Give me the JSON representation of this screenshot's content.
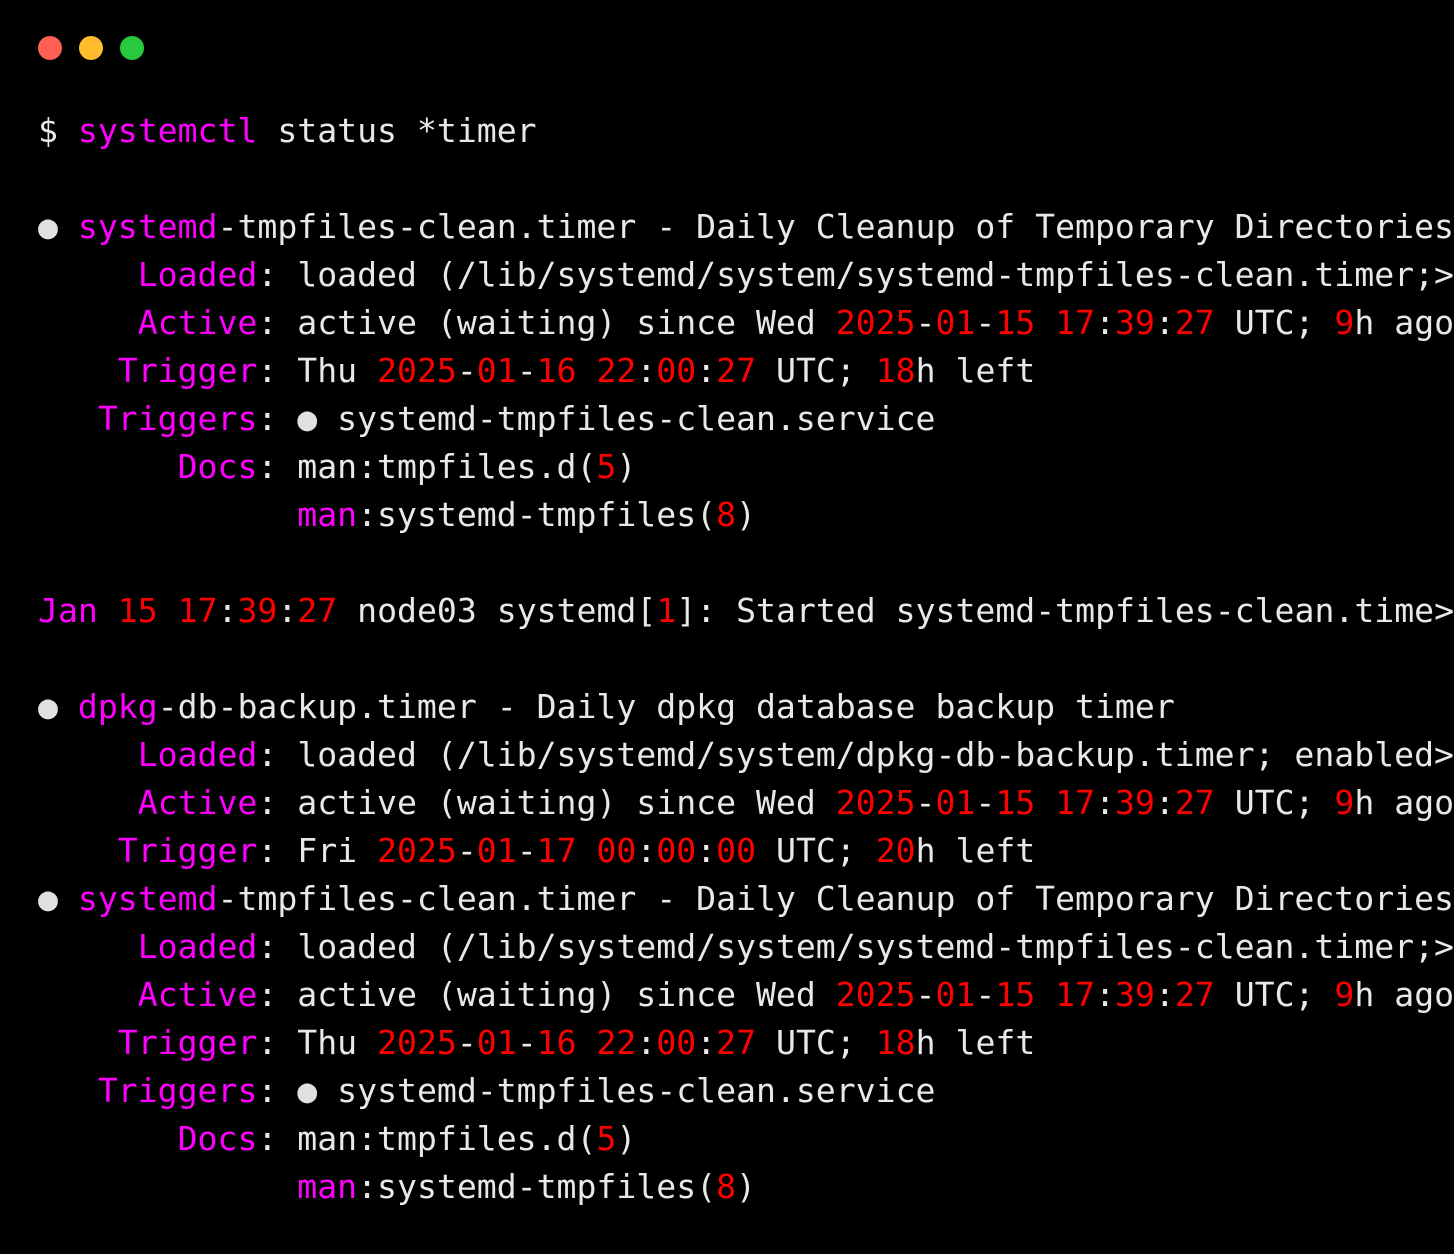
{
  "window": {
    "title": "Terminal",
    "controls": [
      {
        "name": "close",
        "color": "#ff5f56"
      },
      {
        "name": "minimize",
        "color": "#ffbd2e"
      },
      {
        "name": "maximize",
        "color": "#27c93f"
      }
    ]
  },
  "terminal": {
    "background": "#000000",
    "foreground": "#e8e8e8",
    "accent_magenta": "#ff00ff",
    "accent_red": "#ff0000",
    "prompt_symbol": "$",
    "command": "systemctl status *timer",
    "full_command_line": "$ systemctl status *timer"
  },
  "lines": [
    {
      "id": "prompt",
      "tokens": [
        {
          "t": "$ ",
          "c": "white"
        },
        {
          "t": "systemctl",
          "c": "magenta"
        },
        {
          "t": " status *timer",
          "c": "white"
        }
      ]
    },
    {
      "id": "blank-1",
      "tokens": [
        {
          "t": "",
          "c": "white"
        }
      ]
    },
    {
      "id": "unit1-header",
      "tokens": [
        {
          "t": "● ",
          "c": "bullet"
        },
        {
          "t": "systemd",
          "c": "magenta"
        },
        {
          "t": "-tmpfiles-clean.timer - Daily Cleanup of Temporary Directories",
          "c": "white"
        }
      ]
    },
    {
      "id": "unit1-loaded",
      "tokens": [
        {
          "t": "     ",
          "c": "white"
        },
        {
          "t": "Loaded",
          "c": "magenta"
        },
        {
          "t": ": loaded (/lib/systemd/system/systemd-tmpfiles-clean.timer;>",
          "c": "white"
        }
      ]
    },
    {
      "id": "unit1-active",
      "tokens": [
        {
          "t": "     ",
          "c": "white"
        },
        {
          "t": "Active",
          "c": "magenta"
        },
        {
          "t": ": active (waiting) since Wed ",
          "c": "white"
        },
        {
          "t": "2025",
          "c": "red"
        },
        {
          "t": "-",
          "c": "white"
        },
        {
          "t": "01",
          "c": "red"
        },
        {
          "t": "-",
          "c": "white"
        },
        {
          "t": "15",
          "c": "red"
        },
        {
          "t": " ",
          "c": "white"
        },
        {
          "t": "17",
          "c": "red"
        },
        {
          "t": ":",
          "c": "white"
        },
        {
          "t": "39",
          "c": "red"
        },
        {
          "t": ":",
          "c": "white"
        },
        {
          "t": "27",
          "c": "red"
        },
        {
          "t": " UTC; ",
          "c": "white"
        },
        {
          "t": "9",
          "c": "red"
        },
        {
          "t": "h ago",
          "c": "white"
        }
      ]
    },
    {
      "id": "unit1-trigger",
      "tokens": [
        {
          "t": "    ",
          "c": "white"
        },
        {
          "t": "Trigger",
          "c": "magenta"
        },
        {
          "t": ": Thu ",
          "c": "white"
        },
        {
          "t": "2025",
          "c": "red"
        },
        {
          "t": "-",
          "c": "white"
        },
        {
          "t": "01",
          "c": "red"
        },
        {
          "t": "-",
          "c": "white"
        },
        {
          "t": "16",
          "c": "red"
        },
        {
          "t": " ",
          "c": "white"
        },
        {
          "t": "22",
          "c": "red"
        },
        {
          "t": ":",
          "c": "white"
        },
        {
          "t": "00",
          "c": "red"
        },
        {
          "t": ":",
          "c": "white"
        },
        {
          "t": "27",
          "c": "red"
        },
        {
          "t": " UTC; ",
          "c": "white"
        },
        {
          "t": "18",
          "c": "red"
        },
        {
          "t": "h left",
          "c": "white"
        }
      ]
    },
    {
      "id": "unit1-triggers",
      "tokens": [
        {
          "t": "   ",
          "c": "white"
        },
        {
          "t": "Triggers",
          "c": "magenta"
        },
        {
          "t": ": ",
          "c": "white"
        },
        {
          "t": "●",
          "c": "bullet"
        },
        {
          "t": " systemd-tmpfiles-clean.service",
          "c": "white"
        }
      ]
    },
    {
      "id": "unit1-docs",
      "tokens": [
        {
          "t": "       ",
          "c": "white"
        },
        {
          "t": "Docs",
          "c": "magenta"
        },
        {
          "t": ": man:tmpfiles.d(",
          "c": "white"
        },
        {
          "t": "5",
          "c": "red"
        },
        {
          "t": ")",
          "c": "white"
        }
      ]
    },
    {
      "id": "unit1-docs-2",
      "tokens": [
        {
          "t": "             ",
          "c": "white"
        },
        {
          "t": "man",
          "c": "magenta"
        },
        {
          "t": ":systemd-tmpfiles(",
          "c": "white"
        },
        {
          "t": "8",
          "c": "red"
        },
        {
          "t": ")",
          "c": "white"
        }
      ]
    },
    {
      "id": "blank-2",
      "tokens": [
        {
          "t": "",
          "c": "white"
        }
      ]
    },
    {
      "id": "log-1",
      "tokens": [
        {
          "t": "Jan",
          "c": "magenta"
        },
        {
          "t": " ",
          "c": "white"
        },
        {
          "t": "15",
          "c": "red"
        },
        {
          "t": " ",
          "c": "white"
        },
        {
          "t": "17",
          "c": "red"
        },
        {
          "t": ":",
          "c": "white"
        },
        {
          "t": "39",
          "c": "red"
        },
        {
          "t": ":",
          "c": "white"
        },
        {
          "t": "27",
          "c": "red"
        },
        {
          "t": " node03 systemd[",
          "c": "white"
        },
        {
          "t": "1",
          "c": "red"
        },
        {
          "t": "]: Started systemd-tmpfiles-clean.time>",
          "c": "white"
        }
      ]
    },
    {
      "id": "blank-3",
      "tokens": [
        {
          "t": "",
          "c": "white"
        }
      ]
    },
    {
      "id": "unit2-header",
      "tokens": [
        {
          "t": "● ",
          "c": "bullet"
        },
        {
          "t": "dpkg",
          "c": "magenta"
        },
        {
          "t": "-db-backup.timer - Daily dpkg database backup timer",
          "c": "white"
        }
      ]
    },
    {
      "id": "unit2-loaded",
      "tokens": [
        {
          "t": "     ",
          "c": "white"
        },
        {
          "t": "Loaded",
          "c": "magenta"
        },
        {
          "t": ": loaded (/lib/systemd/system/dpkg-db-backup.timer; enabled>",
          "c": "white"
        }
      ]
    },
    {
      "id": "unit2-active",
      "tokens": [
        {
          "t": "     ",
          "c": "white"
        },
        {
          "t": "Active",
          "c": "magenta"
        },
        {
          "t": ": active (waiting) since Wed ",
          "c": "white"
        },
        {
          "t": "2025",
          "c": "red"
        },
        {
          "t": "-",
          "c": "white"
        },
        {
          "t": "01",
          "c": "red"
        },
        {
          "t": "-",
          "c": "white"
        },
        {
          "t": "15",
          "c": "red"
        },
        {
          "t": " ",
          "c": "white"
        },
        {
          "t": "17",
          "c": "red"
        },
        {
          "t": ":",
          "c": "white"
        },
        {
          "t": "39",
          "c": "red"
        },
        {
          "t": ":",
          "c": "white"
        },
        {
          "t": "27",
          "c": "red"
        },
        {
          "t": " UTC; ",
          "c": "white"
        },
        {
          "t": "9",
          "c": "red"
        },
        {
          "t": "h ago",
          "c": "white"
        }
      ]
    },
    {
      "id": "unit2-trigger",
      "tokens": [
        {
          "t": "    ",
          "c": "white"
        },
        {
          "t": "Trigger",
          "c": "magenta"
        },
        {
          "t": ": Fri ",
          "c": "white"
        },
        {
          "t": "2025",
          "c": "red"
        },
        {
          "t": "-",
          "c": "white"
        },
        {
          "t": "01",
          "c": "red"
        },
        {
          "t": "-",
          "c": "white"
        },
        {
          "t": "17",
          "c": "red"
        },
        {
          "t": " ",
          "c": "white"
        },
        {
          "t": "00",
          "c": "red"
        },
        {
          "t": ":",
          "c": "white"
        },
        {
          "t": "00",
          "c": "red"
        },
        {
          "t": ":",
          "c": "white"
        },
        {
          "t": "00",
          "c": "red"
        },
        {
          "t": " UTC; ",
          "c": "white"
        },
        {
          "t": "20",
          "c": "red"
        },
        {
          "t": "h left",
          "c": "white"
        }
      ]
    },
    {
      "id": "unit3-header",
      "tokens": [
        {
          "t": "● ",
          "c": "bullet"
        },
        {
          "t": "systemd",
          "c": "magenta"
        },
        {
          "t": "-tmpfiles-clean.timer - Daily Cleanup of Temporary Directories",
          "c": "white"
        }
      ]
    },
    {
      "id": "unit3-loaded",
      "tokens": [
        {
          "t": "     ",
          "c": "white"
        },
        {
          "t": "Loaded",
          "c": "magenta"
        },
        {
          "t": ": loaded (/lib/systemd/system/systemd-tmpfiles-clean.timer;>",
          "c": "white"
        }
      ]
    },
    {
      "id": "unit3-active",
      "tokens": [
        {
          "t": "     ",
          "c": "white"
        },
        {
          "t": "Active",
          "c": "magenta"
        },
        {
          "t": ": active (waiting) since Wed ",
          "c": "white"
        },
        {
          "t": "2025",
          "c": "red"
        },
        {
          "t": "-",
          "c": "white"
        },
        {
          "t": "01",
          "c": "red"
        },
        {
          "t": "-",
          "c": "white"
        },
        {
          "t": "15",
          "c": "red"
        },
        {
          "t": " ",
          "c": "white"
        },
        {
          "t": "17",
          "c": "red"
        },
        {
          "t": ":",
          "c": "white"
        },
        {
          "t": "39",
          "c": "red"
        },
        {
          "t": ":",
          "c": "white"
        },
        {
          "t": "27",
          "c": "red"
        },
        {
          "t": " UTC; ",
          "c": "white"
        },
        {
          "t": "9",
          "c": "red"
        },
        {
          "t": "h ago",
          "c": "white"
        }
      ]
    },
    {
      "id": "unit3-trigger",
      "tokens": [
        {
          "t": "    ",
          "c": "white"
        },
        {
          "t": "Trigger",
          "c": "magenta"
        },
        {
          "t": ": Thu ",
          "c": "white"
        },
        {
          "t": "2025",
          "c": "red"
        },
        {
          "t": "-",
          "c": "white"
        },
        {
          "t": "01",
          "c": "red"
        },
        {
          "t": "-",
          "c": "white"
        },
        {
          "t": "16",
          "c": "red"
        },
        {
          "t": " ",
          "c": "white"
        },
        {
          "t": "22",
          "c": "red"
        },
        {
          "t": ":",
          "c": "white"
        },
        {
          "t": "00",
          "c": "red"
        },
        {
          "t": ":",
          "c": "white"
        },
        {
          "t": "27",
          "c": "red"
        },
        {
          "t": " UTC; ",
          "c": "white"
        },
        {
          "t": "18",
          "c": "red"
        },
        {
          "t": "h left",
          "c": "white"
        }
      ]
    },
    {
      "id": "unit3-triggers",
      "tokens": [
        {
          "t": "   ",
          "c": "white"
        },
        {
          "t": "Triggers",
          "c": "magenta"
        },
        {
          "t": ": ",
          "c": "white"
        },
        {
          "t": "●",
          "c": "bullet"
        },
        {
          "t": " systemd-tmpfiles-clean.service",
          "c": "white"
        }
      ]
    },
    {
      "id": "unit3-docs",
      "tokens": [
        {
          "t": "       ",
          "c": "white"
        },
        {
          "t": "Docs",
          "c": "magenta"
        },
        {
          "t": ": man:tmpfiles.d(",
          "c": "white"
        },
        {
          "t": "5",
          "c": "red"
        },
        {
          "t": ")",
          "c": "white"
        }
      ]
    },
    {
      "id": "unit3-docs-2",
      "tokens": [
        {
          "t": "             ",
          "c": "white"
        },
        {
          "t": "man",
          "c": "magenta"
        },
        {
          "t": ":systemd-tmpfiles(",
          "c": "white"
        },
        {
          "t": "8",
          "c": "red"
        },
        {
          "t": ")",
          "c": "white"
        }
      ]
    }
  ]
}
